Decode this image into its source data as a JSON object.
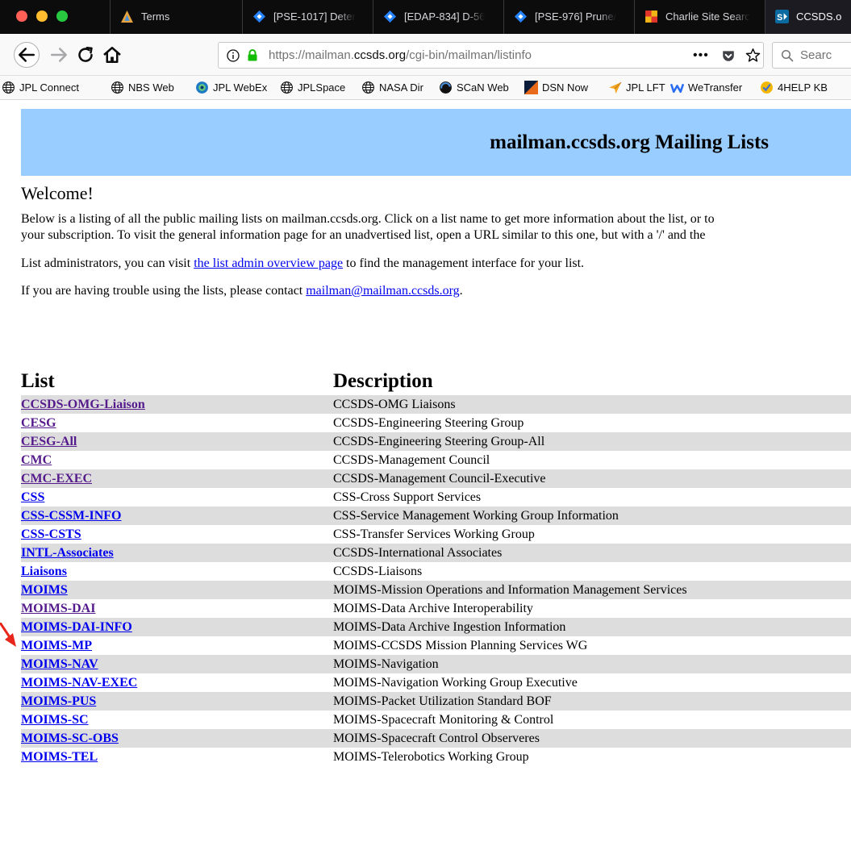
{
  "browser": {
    "tabs": [
      {
        "label": "Terms",
        "icon": "terms-icon"
      },
      {
        "label": "[PSE-1017] Deter",
        "icon": "jira-icon"
      },
      {
        "label": "[EDAP-834] D-56",
        "icon": "jira-icon"
      },
      {
        "label": "[PSE-976] Prune/",
        "icon": "jira-icon"
      },
      {
        "label": "Charlie Site Searc",
        "icon": "charlie-icon"
      },
      {
        "label": "CCSDS.o",
        "icon": "sharepoint-icon"
      }
    ],
    "url": {
      "prefix": "https://mailman.",
      "domain": "ccsds.org",
      "path": "/cgi-bin/mailman/listinfo"
    },
    "search_placeholder": "Searc",
    "bookmarks": [
      "JPL Connect",
      "NBS Web",
      "JPL WebEx",
      "JPLSpace",
      "NASA Dir",
      "SCaN Web",
      "DSN Now",
      "JPL LFT",
      "WeTransfer",
      "4HELP KB"
    ]
  },
  "page": {
    "banner_title": "mailman.ccsds.org Mailing Lists",
    "welcome": "Welcome!",
    "intro_line1": "Below is a listing of all the public mailing lists on mailman.ccsds.org. Click on a list name to get more information about the list, or to",
    "intro_line2": "your subscription. To visit the general information page for an unadvertised list, open a URL similar to this one, but with a '/' and the",
    "admin_before": "List administrators, you can visit ",
    "admin_link": "the list admin overview page",
    "admin_after": " to find the management interface for your list.",
    "trouble_before": "If you are having trouble using the lists, please contact ",
    "trouble_link": "mailman@mailman.ccsds.org",
    "trouble_after": ".",
    "table_header": {
      "list": "List",
      "description": "Description"
    },
    "lists": [
      {
        "name": "CCSDS-OMG-Liaison",
        "description": "CCSDS-OMG Liaisons"
      },
      {
        "name": "CESG",
        "description": "CCSDS-Engineering Steering Group"
      },
      {
        "name": "CESG-All",
        "description": "CCSDS-Engineering Steering Group-All"
      },
      {
        "name": "CMC",
        "description": "CCSDS-Management Council"
      },
      {
        "name": "CMC-EXEC",
        "description": "CCSDS-Management Council-Executive"
      },
      {
        "name": "CSS",
        "description": "CSS-Cross Support Services"
      },
      {
        "name": "CSS-CSSM-INFO",
        "description": "CSS-Service Management Working Group Information"
      },
      {
        "name": "CSS-CSTS",
        "description": "CSS-Transfer Services Working Group"
      },
      {
        "name": "INTL-Associates",
        "description": "CCSDS-International Associates"
      },
      {
        "name": "Liaisons",
        "description": "CCSDS-Liaisons"
      },
      {
        "name": "MOIMS",
        "description": "MOIMS-Mission Operations and Information Management Services"
      },
      {
        "name": "MOIMS-DAI",
        "description": "MOIMS-Data Archive Interoperability"
      },
      {
        "name": "MOIMS-DAI-INFO",
        "description": "MOIMS-Data Archive Ingestion Information"
      },
      {
        "name": "MOIMS-MP",
        "description": "MOIMS-CCSDS Mission Planning Services WG"
      },
      {
        "name": "MOIMS-NAV",
        "description": "MOIMS-Navigation"
      },
      {
        "name": "MOIMS-NAV-EXEC",
        "description": "MOIMS-Navigation Working Group Executive"
      },
      {
        "name": "MOIMS-PUS",
        "description": "MOIMS-Packet Utilization Standard BOF"
      },
      {
        "name": "MOIMS-SC",
        "description": "MOIMS-Spacecraft Monitoring & Control"
      },
      {
        "name": "MOIMS-SC-OBS",
        "description": "MOIMS-Spacecraft Control Observeres"
      },
      {
        "name": "MOIMS-TEL",
        "description": "MOIMS-Telerobotics Working Group"
      }
    ]
  },
  "colors": {
    "banner": "#99ccff",
    "link": "#0000ee",
    "visited": "#551a8b",
    "row_shade": "#dddddd",
    "annotation_arrow": "#e8261c"
  }
}
